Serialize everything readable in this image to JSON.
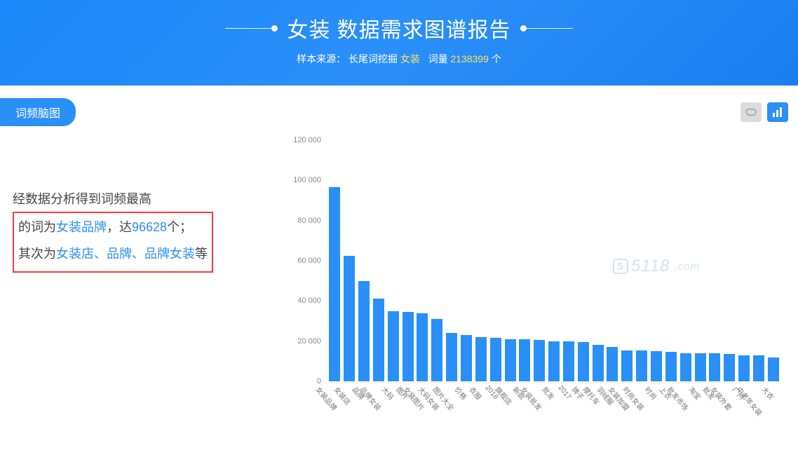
{
  "header": {
    "title": "女装 数据需求图谱报告",
    "sample_label": "样本来源：",
    "sample_source": "长尾词挖掘",
    "sample_keyword": "女装",
    "count_label": "词量",
    "count_value": "2138399",
    "count_suffix": "个"
  },
  "pill": {
    "label": "词频脑图"
  },
  "icon_buttons": {
    "brain": "brain-icon",
    "bar": "bar-chart-icon"
  },
  "analysis": {
    "line1": "经数据分析得到词频最高",
    "line2_a": "的词为",
    "line2_b": "女装品牌",
    "line2_c": "，达",
    "line2_d": "96628",
    "line2_e": "个；",
    "line3_a": "其次为",
    "line3_b": "女装店、品牌、品牌女装",
    "line3_c": "等"
  },
  "watermark": {
    "digits": "5118",
    "suffix": ".com"
  },
  "chart_data": {
    "type": "bar",
    "ylabel": "",
    "xlabel": "",
    "ylim": [
      0,
      120000
    ],
    "yticks": [
      0,
      20000,
      40000,
      60000,
      80000,
      100000,
      120000
    ],
    "ytick_labels": [
      "0",
      "20 000",
      "40 000",
      "60 000",
      "80 000",
      "100 000",
      "120 000"
    ],
    "categories": [
      "女装品牌",
      "女装店",
      "品牌",
      "品牌女装",
      "大码",
      "图片",
      "女装图片",
      "大码女装",
      "图片大全",
      "价格",
      "衣服",
      "2018",
      "旗舰店",
      "新款",
      "女装批发",
      "批发",
      "2017",
      "牌子",
      "摩托车",
      "羽绒服",
      "女装加盟",
      "时尚女装",
      "时尚",
      "上衣",
      "批发市场",
      "淘宝",
      "批发",
      "女装外套",
      "广州",
      "中老年女装",
      "大衣"
    ],
    "values": [
      96628,
      62500,
      50000,
      41000,
      35000,
      34500,
      34000,
      31000,
      24000,
      23000,
      22000,
      21500,
      21000,
      21000,
      20500,
      20000,
      20000,
      19500,
      18000,
      17000,
      15500,
      15500,
      15000,
      14500,
      14000,
      14000,
      14000,
      13500,
      13000,
      13000,
      12000
    ]
  }
}
